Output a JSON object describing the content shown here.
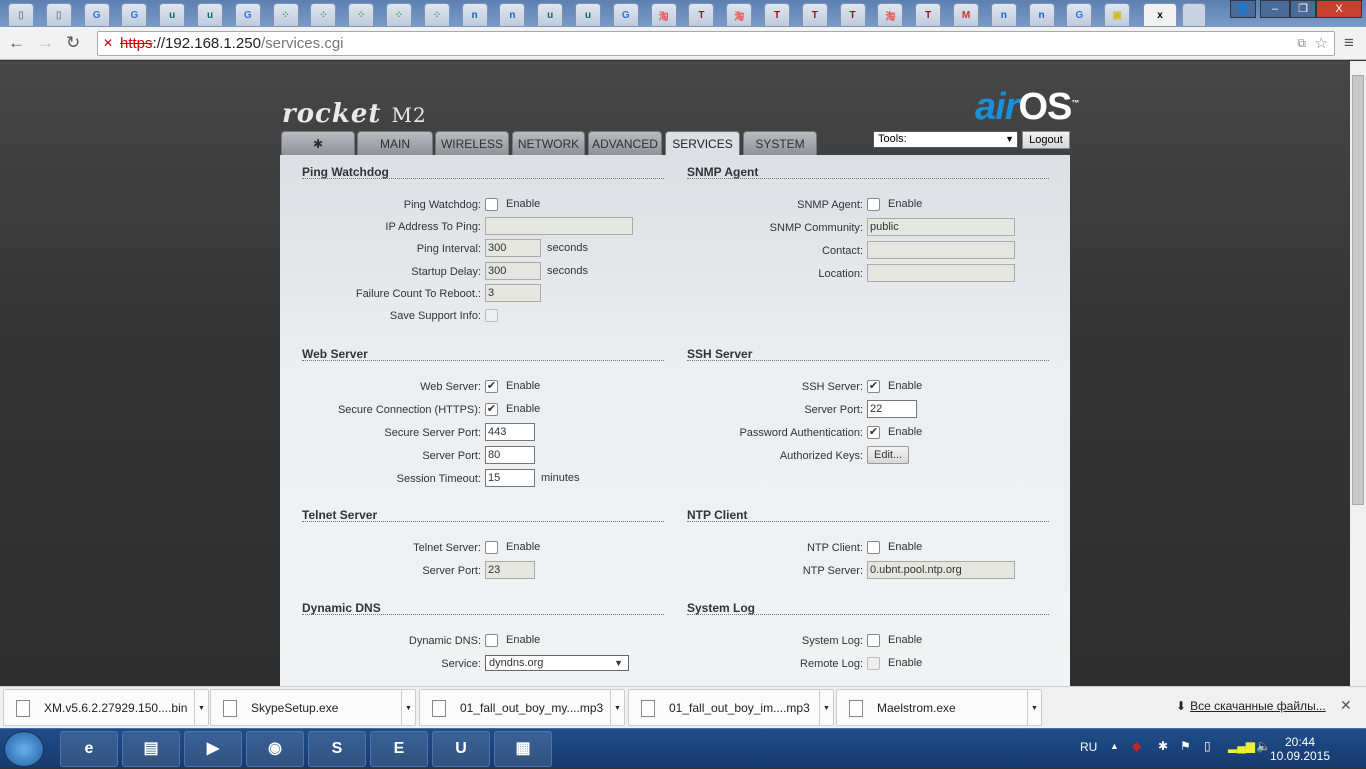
{
  "browser": {
    "tab_icons": [
      "doc",
      "doc",
      "google",
      "google",
      "unity",
      "unity",
      "google",
      "dots",
      "dots",
      "dots",
      "dots",
      "dots",
      "nag",
      "nag",
      "unity",
      "unity",
      "google",
      "taobao",
      "T",
      "taobao",
      "T",
      "T",
      "T",
      "taobao",
      "T",
      "gmail",
      "nag",
      "nag",
      "google",
      "ext"
    ],
    "active_tab_close": "x",
    "url_proto": "https",
    "url_host": "://192.168.1.250",
    "url_path": "/services.cgi"
  },
  "header": {
    "model": "rocket",
    "model_suffix": "M2",
    "brand_air": "air",
    "brand_os": "OS",
    "tm": "™"
  },
  "tabs": [
    {
      "label": "MAIN"
    },
    {
      "label": "WIRELESS"
    },
    {
      "label": "NETWORK"
    },
    {
      "label": "ADVANCED"
    },
    {
      "label": "SERVICES",
      "active": true
    },
    {
      "label": "SYSTEM"
    }
  ],
  "tools": {
    "selected": "Tools:"
  },
  "logout": "Logout",
  "left_sections": [
    {
      "title": "Ping Watchdog",
      "rows": [
        {
          "label": "Ping Watchdog:",
          "type": "check",
          "checked": false,
          "text": "Enable"
        },
        {
          "label": "IP Address To Ping:",
          "type": "input",
          "value": "",
          "width": 148
        },
        {
          "label": "Ping Interval:",
          "type": "input",
          "value": "300",
          "suffix": "seconds",
          "width": 56
        },
        {
          "label": "Startup Delay:",
          "type": "input",
          "value": "300",
          "suffix": "seconds",
          "width": 56
        },
        {
          "label": "Failure Count To Reboot.:",
          "type": "input",
          "value": "3",
          "width": 56
        },
        {
          "label": "Save Support Info:",
          "type": "check",
          "checked": false,
          "disabled": true,
          "text": ""
        }
      ]
    },
    {
      "title": "Web Server",
      "rows": [
        {
          "label": "Web Server:",
          "type": "check",
          "checked": true,
          "text": "Enable"
        },
        {
          "label": "Secure Connection (HTTPS):",
          "type": "check",
          "checked": true,
          "text": "Enable"
        },
        {
          "label": "Secure Server Port:",
          "type": "input",
          "value": "443",
          "enabled": true,
          "width": 50
        },
        {
          "label": "Server Port:",
          "type": "input",
          "value": "80",
          "enabled": true,
          "width": 50
        },
        {
          "label": "Session Timeout:",
          "type": "input",
          "value": "15",
          "enabled": true,
          "suffix": "minutes",
          "width": 50
        }
      ]
    },
    {
      "title": "Telnet Server",
      "rows": [
        {
          "label": "Telnet Server:",
          "type": "check",
          "checked": false,
          "text": "Enable"
        },
        {
          "label": "Server Port:",
          "type": "input",
          "value": "23",
          "width": 50
        }
      ]
    },
    {
      "title": "Dynamic DNS",
      "rows": [
        {
          "label": "Dynamic DNS:",
          "type": "check",
          "checked": false,
          "text": "Enable"
        },
        {
          "label": "Service:",
          "type": "select",
          "value": "dyndns.org",
          "width": 144
        }
      ]
    }
  ],
  "right_sections": [
    {
      "title": "SNMP Agent",
      "rows": [
        {
          "label": "SNMP Agent:",
          "type": "check",
          "checked": false,
          "text": "Enable"
        },
        {
          "label": "SNMP Community:",
          "type": "input",
          "value": "public",
          "width": 148
        },
        {
          "label": "Contact:",
          "type": "input",
          "value": "",
          "width": 148
        },
        {
          "label": "Location:",
          "type": "input",
          "value": "",
          "width": 148
        }
      ]
    },
    {
      "title": "SSH Server",
      "rows": [
        {
          "label": "SSH Server:",
          "type": "check",
          "checked": true,
          "text": "Enable"
        },
        {
          "label": "Server Port:",
          "type": "input",
          "value": "22",
          "enabled": true,
          "width": 50
        },
        {
          "label": "Password Authentication:",
          "type": "check",
          "checked": true,
          "text": "Enable"
        },
        {
          "label": "Authorized Keys:",
          "type": "button",
          "text": "Edit..."
        }
      ]
    },
    {
      "title": "NTP Client",
      "rows": [
        {
          "label": "NTP Client:",
          "type": "check",
          "checked": false,
          "text": "Enable"
        },
        {
          "label": "NTP Server:",
          "type": "input",
          "value": "0.ubnt.pool.ntp.org",
          "width": 148
        }
      ]
    },
    {
      "title": "System Log",
      "rows": [
        {
          "label": "System Log:",
          "type": "check",
          "checked": false,
          "text": "Enable"
        },
        {
          "label": "Remote Log:",
          "type": "check",
          "checked": false,
          "disabled": true,
          "text": "Enable"
        }
      ]
    }
  ],
  "downloads": [
    {
      "name": "XM.v5.6.2.27929.150....bin"
    },
    {
      "name": "SkypeSetup.exe"
    },
    {
      "name": "01_fall_out_boy_my....mp3"
    },
    {
      "name": "01_fall_out_boy_im....mp3"
    },
    {
      "name": "Maelstrom.exe"
    }
  ],
  "all_downloads": "Все скачанные файлы...",
  "taskbar": {
    "apps": [
      "ie",
      "explorer",
      "media",
      "chrome",
      "skype",
      "epic",
      "unreal",
      "control-panel"
    ],
    "lang": "RU",
    "time": "20:44",
    "date": "10.09.2015"
  }
}
